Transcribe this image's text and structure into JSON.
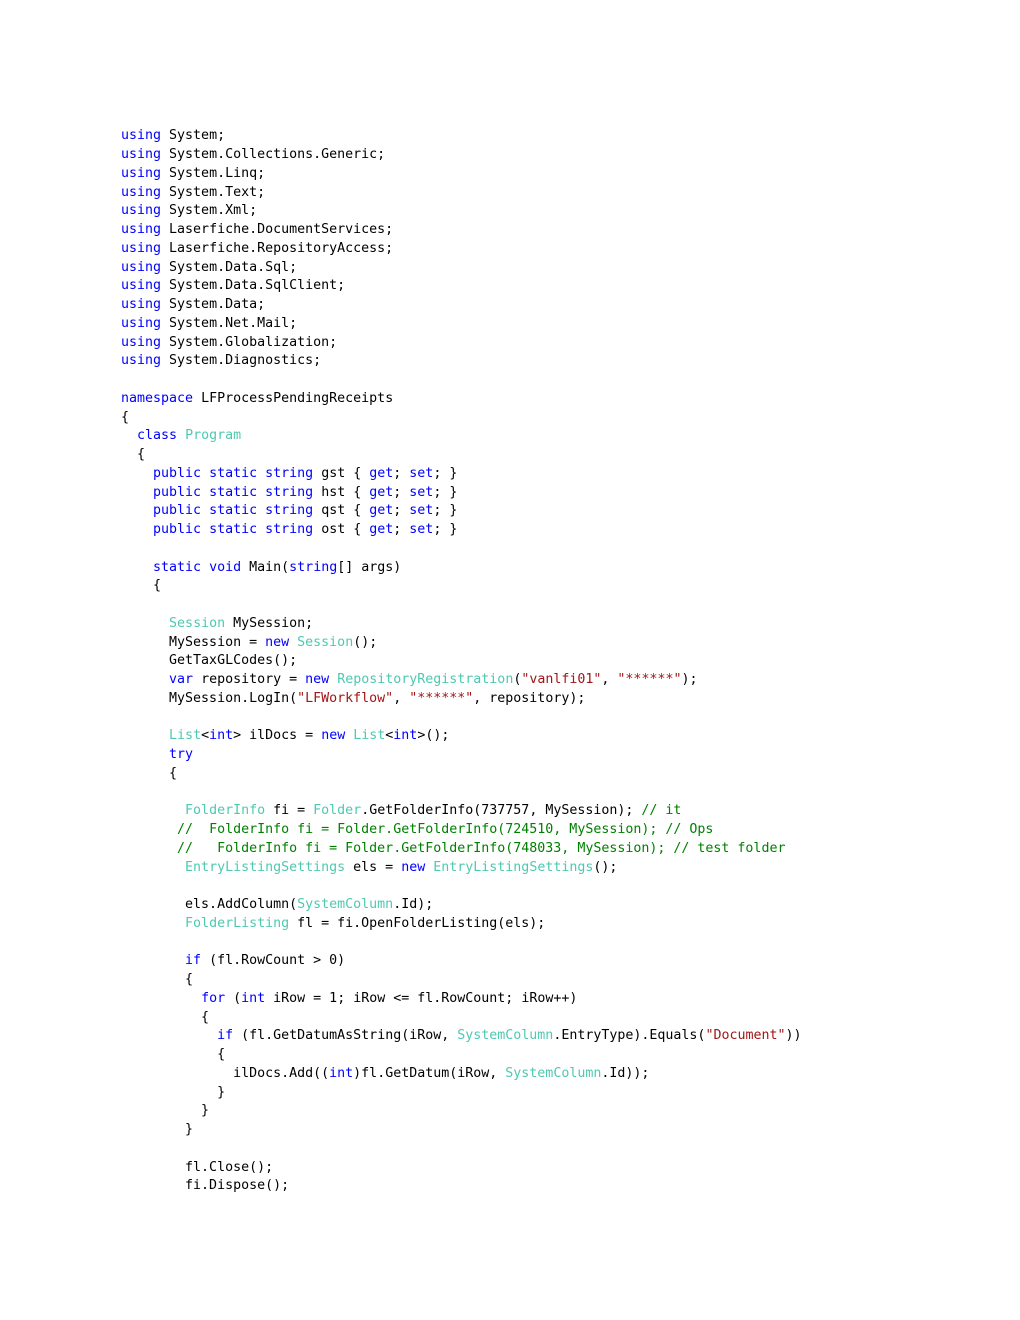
{
  "document": {
    "kind": "source-code-listing",
    "language": "C#",
    "namespace": "LFProcessPendingReceipts",
    "class": "Program",
    "method": "Main"
  },
  "colors": {
    "background": "#ffffff",
    "plain_text": "#000000",
    "keyword": "#0000ff",
    "type": "#4ec9b0",
    "string": "#a31515",
    "comment": "#008000"
  },
  "code": {
    "lines": [
      [
        {
          "t": "using",
          "c": "kw"
        },
        {
          "t": " System;",
          "c": "pln"
        }
      ],
      [
        {
          "t": "using",
          "c": "kw"
        },
        {
          "t": " System.Collections.Generic;",
          "c": "pln"
        }
      ],
      [
        {
          "t": "using",
          "c": "kw"
        },
        {
          "t": " System.Linq;",
          "c": "pln"
        }
      ],
      [
        {
          "t": "using",
          "c": "kw"
        },
        {
          "t": " System.Text;",
          "c": "pln"
        }
      ],
      [
        {
          "t": "using",
          "c": "kw"
        },
        {
          "t": " System.Xml;",
          "c": "pln"
        }
      ],
      [
        {
          "t": "using",
          "c": "kw"
        },
        {
          "t": " Laserfiche.DocumentServices;",
          "c": "pln"
        }
      ],
      [
        {
          "t": "using",
          "c": "kw"
        },
        {
          "t": " Laserfiche.RepositoryAccess;",
          "c": "pln"
        }
      ],
      [
        {
          "t": "using",
          "c": "kw"
        },
        {
          "t": " System.Data.Sql;",
          "c": "pln"
        }
      ],
      [
        {
          "t": "using",
          "c": "kw"
        },
        {
          "t": " System.Data.SqlClient;",
          "c": "pln"
        }
      ],
      [
        {
          "t": "using",
          "c": "kw"
        },
        {
          "t": " System.Data;",
          "c": "pln"
        }
      ],
      [
        {
          "t": "using",
          "c": "kw"
        },
        {
          "t": " System.Net.Mail;",
          "c": "pln"
        }
      ],
      [
        {
          "t": "using",
          "c": "kw"
        },
        {
          "t": " System.Globalization;",
          "c": "pln"
        }
      ],
      [
        {
          "t": "using",
          "c": "kw"
        },
        {
          "t": " System.Diagnostics;",
          "c": "pln"
        }
      ],
      [],
      [
        {
          "t": "namespace",
          "c": "kw"
        },
        {
          "t": " LFProcessPendingReceipts",
          "c": "pln"
        }
      ],
      [
        {
          "t": "{",
          "c": "pln"
        }
      ],
      [
        {
          "t": "  ",
          "c": "pln"
        },
        {
          "t": "class",
          "c": "kw"
        },
        {
          "t": " ",
          "c": "pln"
        },
        {
          "t": "Program",
          "c": "type"
        }
      ],
      [
        {
          "t": "  {",
          "c": "pln"
        }
      ],
      [
        {
          "t": "    ",
          "c": "pln"
        },
        {
          "t": "public",
          "c": "kw"
        },
        {
          "t": " ",
          "c": "pln"
        },
        {
          "t": "static",
          "c": "kw"
        },
        {
          "t": " ",
          "c": "pln"
        },
        {
          "t": "string",
          "c": "kw"
        },
        {
          "t": " gst { ",
          "c": "pln"
        },
        {
          "t": "get",
          "c": "kw"
        },
        {
          "t": "; ",
          "c": "pln"
        },
        {
          "t": "set",
          "c": "kw"
        },
        {
          "t": "; }",
          "c": "pln"
        }
      ],
      [
        {
          "t": "    ",
          "c": "pln"
        },
        {
          "t": "public",
          "c": "kw"
        },
        {
          "t": " ",
          "c": "pln"
        },
        {
          "t": "static",
          "c": "kw"
        },
        {
          "t": " ",
          "c": "pln"
        },
        {
          "t": "string",
          "c": "kw"
        },
        {
          "t": " hst { ",
          "c": "pln"
        },
        {
          "t": "get",
          "c": "kw"
        },
        {
          "t": "; ",
          "c": "pln"
        },
        {
          "t": "set",
          "c": "kw"
        },
        {
          "t": "; }",
          "c": "pln"
        }
      ],
      [
        {
          "t": "    ",
          "c": "pln"
        },
        {
          "t": "public",
          "c": "kw"
        },
        {
          "t": " ",
          "c": "pln"
        },
        {
          "t": "static",
          "c": "kw"
        },
        {
          "t": " ",
          "c": "pln"
        },
        {
          "t": "string",
          "c": "kw"
        },
        {
          "t": " qst { ",
          "c": "pln"
        },
        {
          "t": "get",
          "c": "kw"
        },
        {
          "t": "; ",
          "c": "pln"
        },
        {
          "t": "set",
          "c": "kw"
        },
        {
          "t": "; }",
          "c": "pln"
        }
      ],
      [
        {
          "t": "    ",
          "c": "pln"
        },
        {
          "t": "public",
          "c": "kw"
        },
        {
          "t": " ",
          "c": "pln"
        },
        {
          "t": "static",
          "c": "kw"
        },
        {
          "t": " ",
          "c": "pln"
        },
        {
          "t": "string",
          "c": "kw"
        },
        {
          "t": " ost { ",
          "c": "pln"
        },
        {
          "t": "get",
          "c": "kw"
        },
        {
          "t": "; ",
          "c": "pln"
        },
        {
          "t": "set",
          "c": "kw"
        },
        {
          "t": "; }",
          "c": "pln"
        }
      ],
      [],
      [
        {
          "t": "    ",
          "c": "pln"
        },
        {
          "t": "static",
          "c": "kw"
        },
        {
          "t": " ",
          "c": "pln"
        },
        {
          "t": "void",
          "c": "kw"
        },
        {
          "t": " Main(",
          "c": "pln"
        },
        {
          "t": "string",
          "c": "kw"
        },
        {
          "t": "[] args)",
          "c": "pln"
        }
      ],
      [
        {
          "t": "    {",
          "c": "pln"
        }
      ],
      [],
      [
        {
          "t": "      ",
          "c": "pln"
        },
        {
          "t": "Session",
          "c": "type"
        },
        {
          "t": " MySession;",
          "c": "pln"
        }
      ],
      [
        {
          "t": "      MySession = ",
          "c": "pln"
        },
        {
          "t": "new",
          "c": "kw"
        },
        {
          "t": " ",
          "c": "pln"
        },
        {
          "t": "Session",
          "c": "type"
        },
        {
          "t": "();",
          "c": "pln"
        }
      ],
      [
        {
          "t": "      GetTaxGLCodes();",
          "c": "pln"
        }
      ],
      [
        {
          "t": "      ",
          "c": "pln"
        },
        {
          "t": "var",
          "c": "kw"
        },
        {
          "t": " repository = ",
          "c": "pln"
        },
        {
          "t": "new",
          "c": "kw"
        },
        {
          "t": " ",
          "c": "pln"
        },
        {
          "t": "RepositoryRegistration",
          "c": "type"
        },
        {
          "t": "(",
          "c": "pln"
        },
        {
          "t": "\"vanlfi01\"",
          "c": "str"
        },
        {
          "t": ", ",
          "c": "pln"
        },
        {
          "t": "\"******\"",
          "c": "str"
        },
        {
          "t": ");",
          "c": "pln"
        }
      ],
      [
        {
          "t": "      MySession.LogIn(",
          "c": "pln"
        },
        {
          "t": "\"LFWorkflow\"",
          "c": "str"
        },
        {
          "t": ", ",
          "c": "pln"
        },
        {
          "t": "\"******\"",
          "c": "str"
        },
        {
          "t": ", repository);",
          "c": "pln"
        }
      ],
      [],
      [
        {
          "t": "      ",
          "c": "pln"
        },
        {
          "t": "List",
          "c": "type"
        },
        {
          "t": "<",
          "c": "pln"
        },
        {
          "t": "int",
          "c": "kw"
        },
        {
          "t": "> ilDocs = ",
          "c": "pln"
        },
        {
          "t": "new",
          "c": "kw"
        },
        {
          "t": " ",
          "c": "pln"
        },
        {
          "t": "List",
          "c": "type"
        },
        {
          "t": "<",
          "c": "pln"
        },
        {
          "t": "int",
          "c": "kw"
        },
        {
          "t": ">();",
          "c": "pln"
        }
      ],
      [
        {
          "t": "      ",
          "c": "pln"
        },
        {
          "t": "try",
          "c": "kw"
        }
      ],
      [
        {
          "t": "      {",
          "c": "pln"
        }
      ],
      [],
      [
        {
          "t": "        ",
          "c": "pln"
        },
        {
          "t": "FolderInfo",
          "c": "type"
        },
        {
          "t": " fi = ",
          "c": "pln"
        },
        {
          "t": "Folder",
          "c": "type"
        },
        {
          "t": ".GetFolderInfo(737757, MySession); ",
          "c": "pln"
        },
        {
          "t": "// it",
          "c": "com"
        }
      ],
      [
        {
          "t": "       ",
          "c": "pln"
        },
        {
          "t": "//  FolderInfo fi = Folder.GetFolderInfo(724510, MySession); // Ops",
          "c": "com"
        }
      ],
      [
        {
          "t": "       ",
          "c": "pln"
        },
        {
          "t": "//   FolderInfo fi = Folder.GetFolderInfo(748033, MySession); // test folder",
          "c": "com"
        }
      ],
      [
        {
          "t": "        ",
          "c": "pln"
        },
        {
          "t": "EntryListingSettings",
          "c": "type"
        },
        {
          "t": " els = ",
          "c": "pln"
        },
        {
          "t": "new",
          "c": "kw"
        },
        {
          "t": " ",
          "c": "pln"
        },
        {
          "t": "EntryListingSettings",
          "c": "type"
        },
        {
          "t": "();",
          "c": "pln"
        }
      ],
      [],
      [
        {
          "t": "        els.AddColumn(",
          "c": "pln"
        },
        {
          "t": "SystemColumn",
          "c": "type"
        },
        {
          "t": ".Id);",
          "c": "pln"
        }
      ],
      [
        {
          "t": "        ",
          "c": "pln"
        },
        {
          "t": "FolderListing",
          "c": "type"
        },
        {
          "t": " fl = fi.OpenFolderListing(els);",
          "c": "pln"
        }
      ],
      [],
      [
        {
          "t": "        ",
          "c": "pln"
        },
        {
          "t": "if",
          "c": "kw"
        },
        {
          "t": " (fl.RowCount > 0)",
          "c": "pln"
        }
      ],
      [
        {
          "t": "        {",
          "c": "pln"
        }
      ],
      [
        {
          "t": "          ",
          "c": "pln"
        },
        {
          "t": "for",
          "c": "kw"
        },
        {
          "t": " (",
          "c": "pln"
        },
        {
          "t": "int",
          "c": "kw"
        },
        {
          "t": " iRow = 1; iRow <= fl.RowCount; iRow++)",
          "c": "pln"
        }
      ],
      [
        {
          "t": "          {",
          "c": "pln"
        }
      ],
      [
        {
          "t": "            ",
          "c": "pln"
        },
        {
          "t": "if",
          "c": "kw"
        },
        {
          "t": " (fl.GetDatumAsString(iRow, ",
          "c": "pln"
        },
        {
          "t": "SystemColumn",
          "c": "type"
        },
        {
          "t": ".EntryType).Equals(",
          "c": "pln"
        },
        {
          "t": "\"Document\"",
          "c": "str"
        },
        {
          "t": "))",
          "c": "pln"
        }
      ],
      [
        {
          "t": "            {",
          "c": "pln"
        }
      ],
      [
        {
          "t": "              ilDocs.Add((",
          "c": "pln"
        },
        {
          "t": "int",
          "c": "kw"
        },
        {
          "t": ")fl.GetDatum(iRow, ",
          "c": "pln"
        },
        {
          "t": "SystemColumn",
          "c": "type"
        },
        {
          "t": ".Id));",
          "c": "pln"
        }
      ],
      [
        {
          "t": "            }",
          "c": "pln"
        }
      ],
      [
        {
          "t": "          }",
          "c": "pln"
        }
      ],
      [
        {
          "t": "        }",
          "c": "pln"
        }
      ],
      [],
      [
        {
          "t": "        fl.Close();",
          "c": "pln"
        }
      ],
      [
        {
          "t": "        fi.Dispose();",
          "c": "pln"
        }
      ]
    ]
  }
}
